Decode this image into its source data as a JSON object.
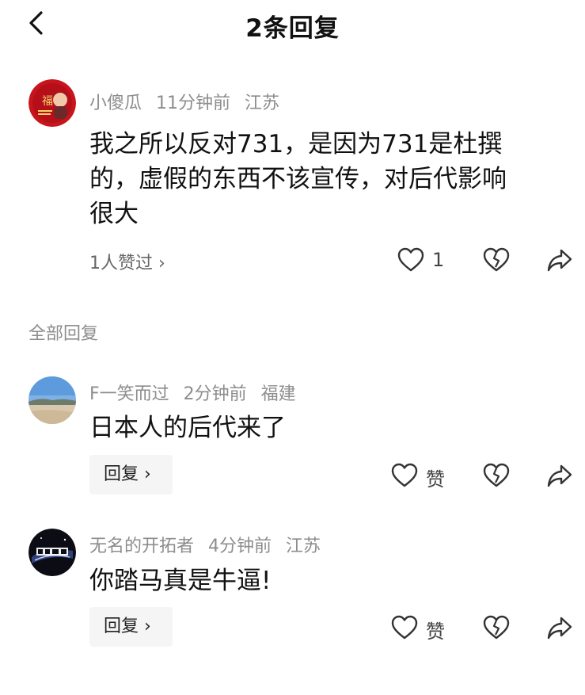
{
  "header": {
    "title": "2条回复",
    "back_icon": "chevron-left-icon"
  },
  "main_comment": {
    "username": "小傻瓜",
    "time": "11分钟前",
    "location": "江苏",
    "text_lines": [
      "我之所以反对731，是因为731是杜撰",
      "的，虚假的东西不该宣传，对后代影响",
      "很大"
    ],
    "likes_summary": "1人赞过 ›",
    "like_count": "1"
  },
  "section": {
    "all_replies_label": "全部回复"
  },
  "replies": [
    {
      "username": "F一笑而过",
      "time": "2分钟前",
      "location": "福建",
      "text": "日本人的后代来了",
      "reply_label": "回复 ›",
      "like_label": "赞"
    },
    {
      "username": "无名的开拓者",
      "time": "4分钟前",
      "location": "江苏",
      "text": "你踏马真是牛逼!",
      "reply_label": "回复 ›",
      "like_label": "赞"
    }
  ]
}
